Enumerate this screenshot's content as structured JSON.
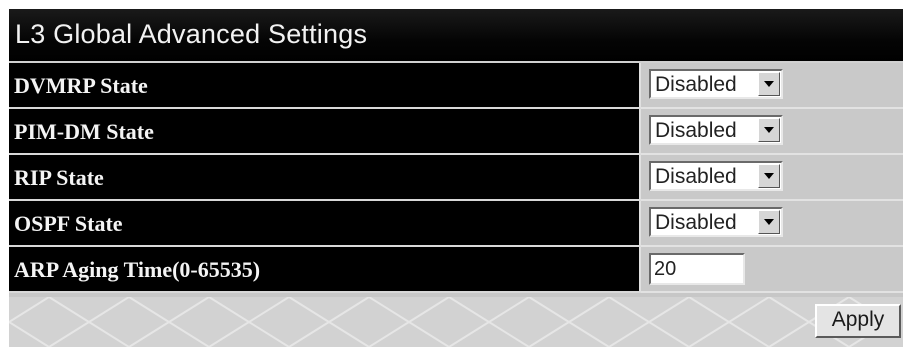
{
  "panel": {
    "title": "L3 Global Advanced Settings"
  },
  "rows": [
    {
      "label": "DVMRP State",
      "control": "select",
      "value": "Disabled"
    },
    {
      "label": "PIM-DM State",
      "control": "select",
      "value": "Disabled"
    },
    {
      "label": "RIP State",
      "control": "select",
      "value": "Disabled"
    },
    {
      "label": "OSPF State",
      "control": "select",
      "value": "Disabled"
    },
    {
      "label": "ARP Aging Time(0-65535)",
      "control": "input",
      "value": "20"
    }
  ],
  "actions": {
    "apply_label": "Apply"
  },
  "colors": {
    "header_bg": "#000000",
    "label_cell_bg": "#000000",
    "value_cell_bg": "#c9c9c9",
    "label_text": "#f4f4f4"
  }
}
